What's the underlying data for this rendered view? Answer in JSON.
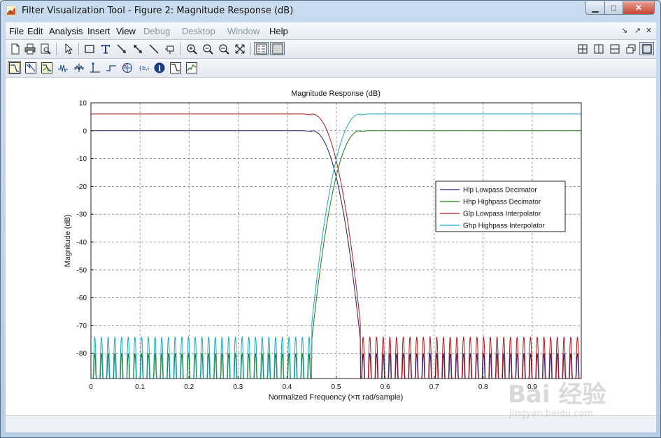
{
  "window": {
    "title": "Filter Visualization Tool - Figure 2: Magnitude Response (dB)",
    "controls": {
      "minimize": "▁",
      "maximize": "□",
      "close": "✕"
    }
  },
  "menubar": {
    "items": [
      {
        "label": "File",
        "enabled": true
      },
      {
        "label": "Edit",
        "enabled": true
      },
      {
        "label": "Analysis",
        "enabled": true
      },
      {
        "label": "Insert",
        "enabled": true
      },
      {
        "label": "View",
        "enabled": true
      },
      {
        "label": "Debug",
        "enabled": false
      },
      {
        "label": "Desktop",
        "enabled": false
      },
      {
        "label": "Window",
        "enabled": false
      },
      {
        "label": "Help",
        "enabled": true
      }
    ]
  },
  "toolbar": {
    "icons": [
      "new-figure-icon",
      "print-icon",
      "print-preview-icon",
      "select-arrow-icon",
      "insert-rectangle-icon",
      "insert-text-icon",
      "insert-arrow-icon",
      "insert-double-arrow-icon",
      "insert-line-icon",
      "pin-icon",
      "zoom-in-icon",
      "zoom-out-icon",
      "zoom-x-icon",
      "zoom-full-icon",
      "legend-toggle-icon",
      "grid-toggle-icon"
    ],
    "layout_icons": [
      "tile-icon",
      "split-vertical-icon",
      "split-horizontal-icon",
      "cascade-icon",
      "maximize-icon"
    ]
  },
  "analysis_toolbar": {
    "icons": [
      "magnitude-response-icon",
      "phase-response-icon",
      "magnitude-phase-icon",
      "group-delay-icon",
      "phase-delay-icon",
      "impulse-response-icon",
      "step-response-icon",
      "pole-zero-icon",
      "coefficients-icon",
      "filter-info-icon",
      "magnitude-estimate-icon",
      "noise-power-icon"
    ]
  },
  "colors": {
    "hlp": "#1f1f7a",
    "hhp": "#1a7a1a",
    "glp": "#b01a1a",
    "ghp": "#19a8c2"
  },
  "chart_data": {
    "type": "line",
    "title": "Magnitude Response (dB)",
    "xlabel": "Normalized Frequency (×π rad/sample)",
    "ylabel": "Magnitude (dB)",
    "xlim": [
      0,
      1
    ],
    "ylim": [
      -89,
      10
    ],
    "xticks": [
      0,
      0.1,
      0.2,
      0.3,
      0.4,
      0.5,
      0.6,
      0.7,
      0.8,
      0.9
    ],
    "yticks": [
      10,
      0,
      -10,
      -20,
      -30,
      -40,
      -50,
      -60,
      -70,
      -80
    ],
    "grid": true,
    "legend_position": "right",
    "series": [
      {
        "name": "Hlp Lowpass Decimator",
        "kind": "lowpass",
        "passband_db": 0,
        "passband_edge": 0.45,
        "stopband_edge": 0.55,
        "stopband_db": -76,
        "color": "#1f1f7a"
      },
      {
        "name": "Hhp Highpass Decimator",
        "kind": "highpass",
        "passband_db": 0,
        "passband_edge": 0.55,
        "stopband_edge": 0.45,
        "stopband_db": -76,
        "color": "#1a7a1a"
      },
      {
        "name": "Glp Lowpass Interpolator",
        "kind": "lowpass",
        "passband_db": 6,
        "passband_edge": 0.45,
        "stopband_edge": 0.55,
        "stopband_db": -70,
        "color": "#b01a1a"
      },
      {
        "name": "Ghp Highpass Interpolator",
        "kind": "highpass",
        "passband_db": 6,
        "passband_edge": 0.55,
        "stopband_edge": 0.45,
        "stopband_db": -70,
        "color": "#19a8c2"
      }
    ]
  },
  "watermark": {
    "main": "Bai 经验",
    "sub": "jingyan.baidu.com"
  }
}
